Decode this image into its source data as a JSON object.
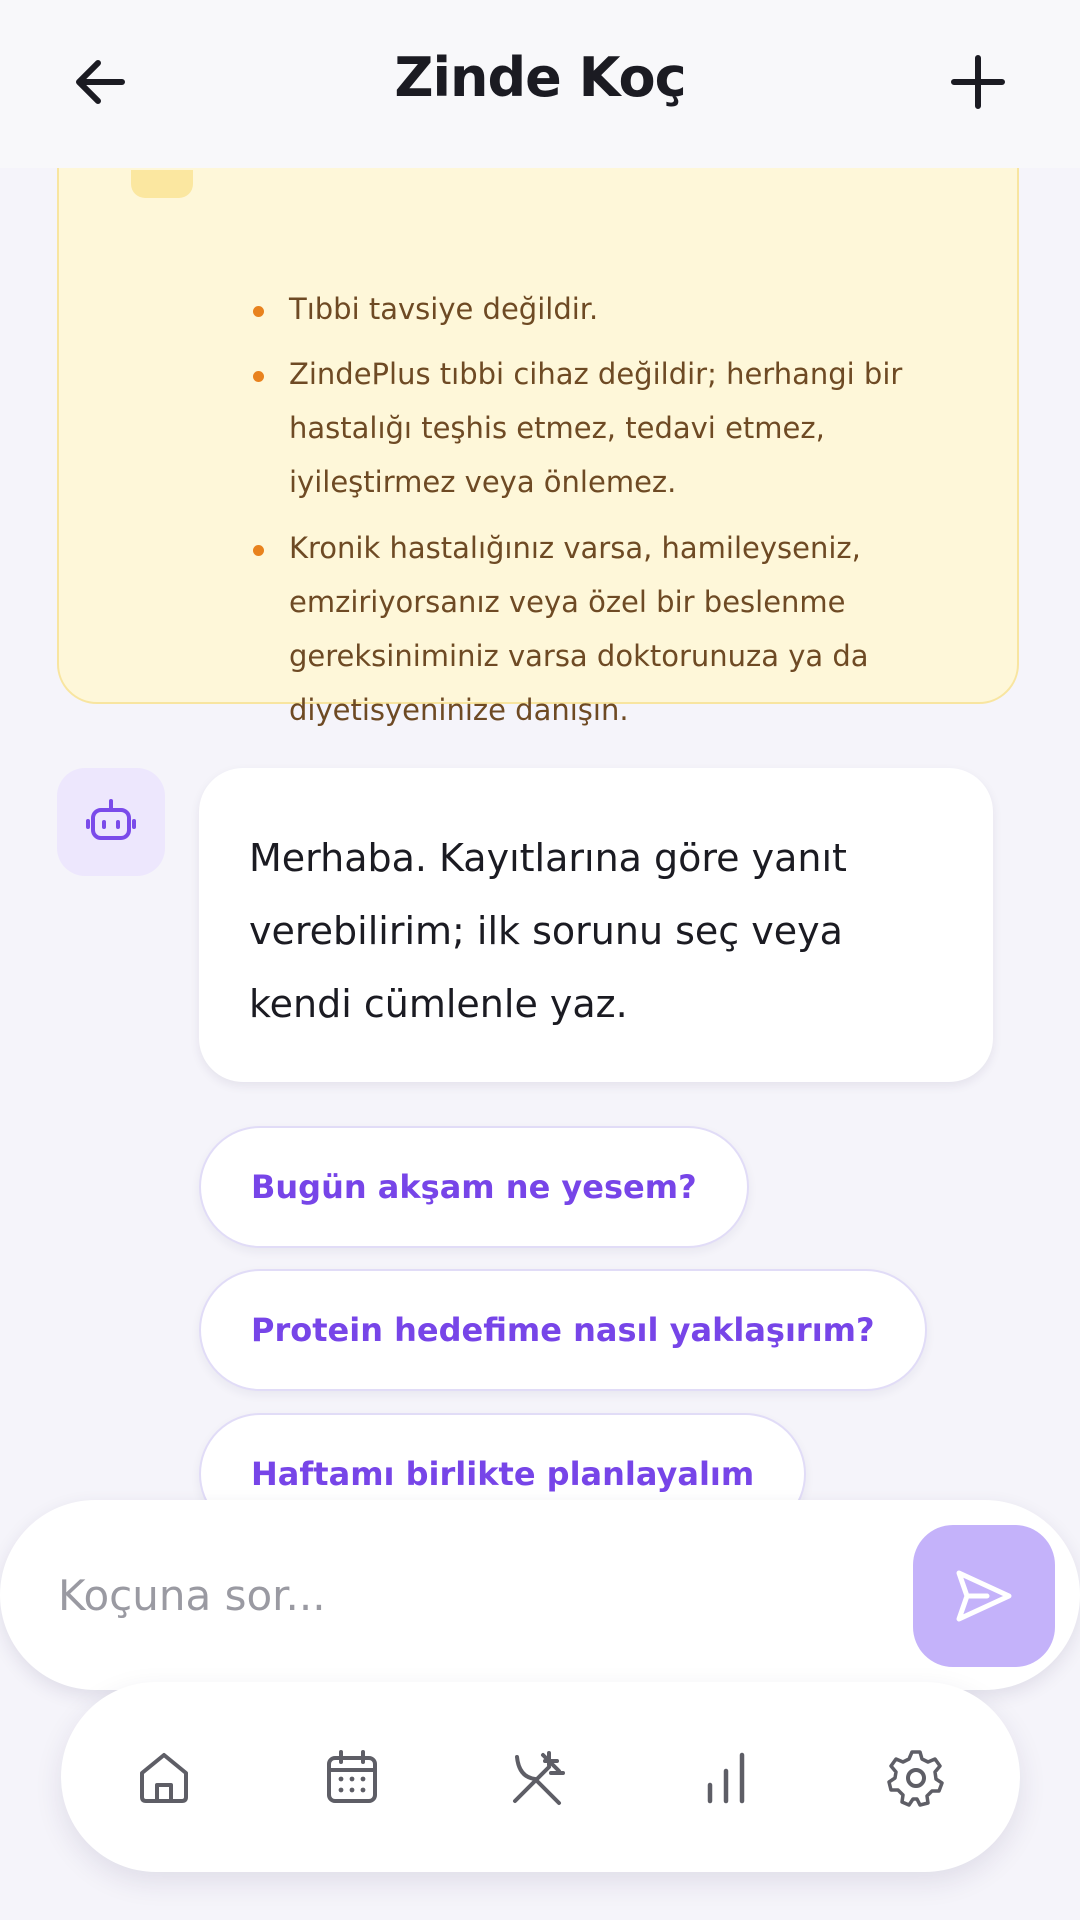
{
  "header": {
    "title": "Zinde Koç",
    "back_icon": "arrow-left-icon",
    "new_icon": "plus-icon"
  },
  "disclaimer": {
    "items": [
      "Tıbbi tavsiye değildir.",
      "ZindePlus tıbbi cihaz değildir; herhangi bir hastalığı teşhis etmez, tedavi etmez, iyileştirmez veya önlemez.",
      "Kronik hastalığınız varsa, hamileyseniz, emziriyorsanız veya özel bir beslenme gereksiniminiz varsa doktorunuza ya da diyetisyeninize danışın."
    ]
  },
  "chat": {
    "bot_message": "Merhaba. Kayıtlarına göre yanıt verebilirim; ilk sorunu seç veya kendi cümlenle yaz.",
    "suggestions": [
      "Bugün akşam ne yesem?",
      "Protein hedefime nasıl yaklaşırım?",
      "Haftamı birlikte planlayalım"
    ]
  },
  "composer": {
    "placeholder": "Koçuna sor...",
    "value": "",
    "send_icon": "send-icon"
  },
  "nav": {
    "items": [
      "home-icon",
      "calendar-icon",
      "fork-knife-icon",
      "stats-icon",
      "settings-icon"
    ]
  },
  "colors": {
    "accent": "#7745E8",
    "send_button": "#C4B2FA",
    "disclaimer_bg": "#FEF7D9",
    "bullet": "#E8821E"
  }
}
